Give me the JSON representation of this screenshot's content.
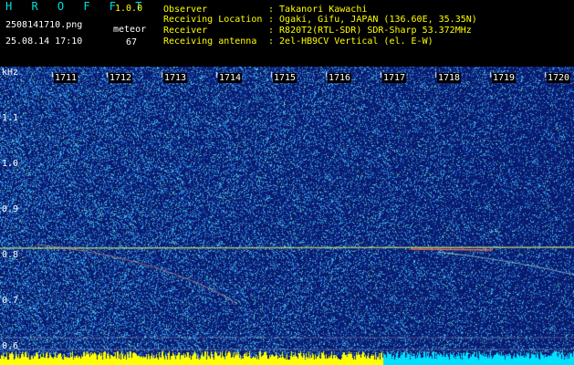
{
  "header": {
    "app_name": "H R O F F T",
    "version": "1.0.0",
    "filename": "2508141710.png",
    "datetime": "25.08.14 17:10",
    "meteor_label": "meteor",
    "meteor_count": "67"
  },
  "info": {
    "rows": [
      {
        "label": "Observer",
        "value": ": Takanori Kawachi"
      },
      {
        "label": "Receiving Location",
        "value": ": Ogaki, Gifu, JAPAN (136.60E, 35.35N)"
      },
      {
        "label": "Receiver",
        "value": ": R820T2(RTL-SDR) SDR-Sharp 53.372MHz"
      },
      {
        "label": "Receiving antenna",
        "value": ": 2el-HB9CV Vertical (el. E-W)"
      }
    ]
  },
  "spectrogram": {
    "y_unit": "kHz",
    "y_ticks": [
      "1.1",
      "1.0",
      "0.9",
      "0.8",
      "0.7",
      "0.6"
    ],
    "time_ticks": [
      "1711",
      "1712",
      "1713",
      "1714",
      "1715",
      "1716",
      "1717",
      "1718",
      "1719",
      "1720"
    ],
    "colors": {
      "background": "#0a1a6e",
      "noise": "#1e5fd0",
      "signal": "#ffff00",
      "baseline": "#00e0ff"
    }
  }
}
